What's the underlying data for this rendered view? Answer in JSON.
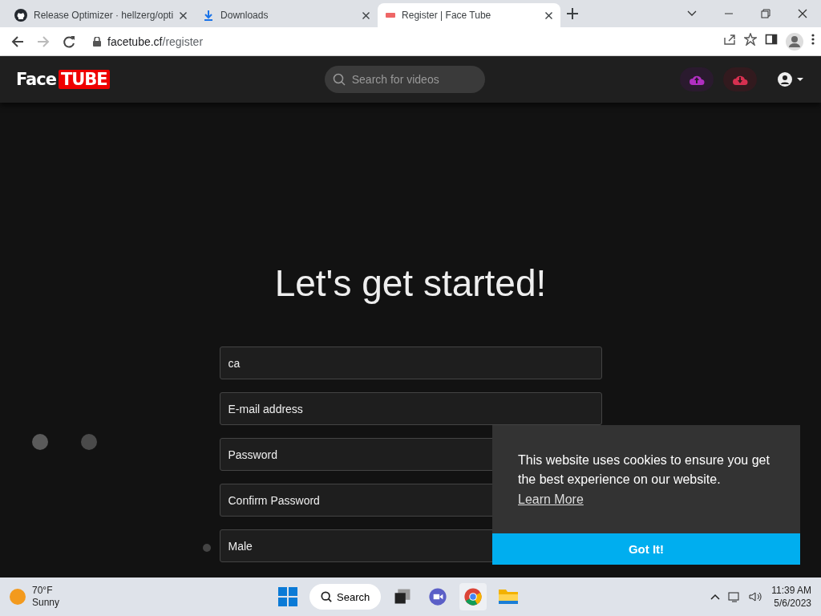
{
  "browser": {
    "tabs": [
      {
        "title": "Release Optimizer · hellzerg/opti",
        "selected": false,
        "kind": "github"
      },
      {
        "title": "Downloads",
        "selected": false,
        "kind": "download"
      },
      {
        "title": "Register | Face Tube",
        "selected": true,
        "kind": "site"
      }
    ],
    "url_host": "facetube.cf",
    "url_path": "/register"
  },
  "site": {
    "logo_left": "Face",
    "logo_right": "TUBE",
    "search": {
      "placeholder": "Search for videos"
    }
  },
  "form": {
    "heading": "Let's get started!",
    "fields": [
      {
        "kind": "text",
        "value": "ca"
      },
      {
        "kind": "text",
        "placeholder": "E-mail address"
      },
      {
        "kind": "password",
        "placeholder": "Password"
      },
      {
        "kind": "password",
        "placeholder": "Confirm Password"
      },
      {
        "kind": "select",
        "value": "Male"
      }
    ]
  },
  "cookie_banner": {
    "message": "This website uses cookies to ensure you get the best experience on our website.",
    "link": "Learn More",
    "button": "Got It!"
  },
  "taskbar": {
    "weather_temp": "70°F",
    "weather_text": "Sunny",
    "search": "Search",
    "time": "11:39 AM",
    "date": "5/6/2023"
  }
}
